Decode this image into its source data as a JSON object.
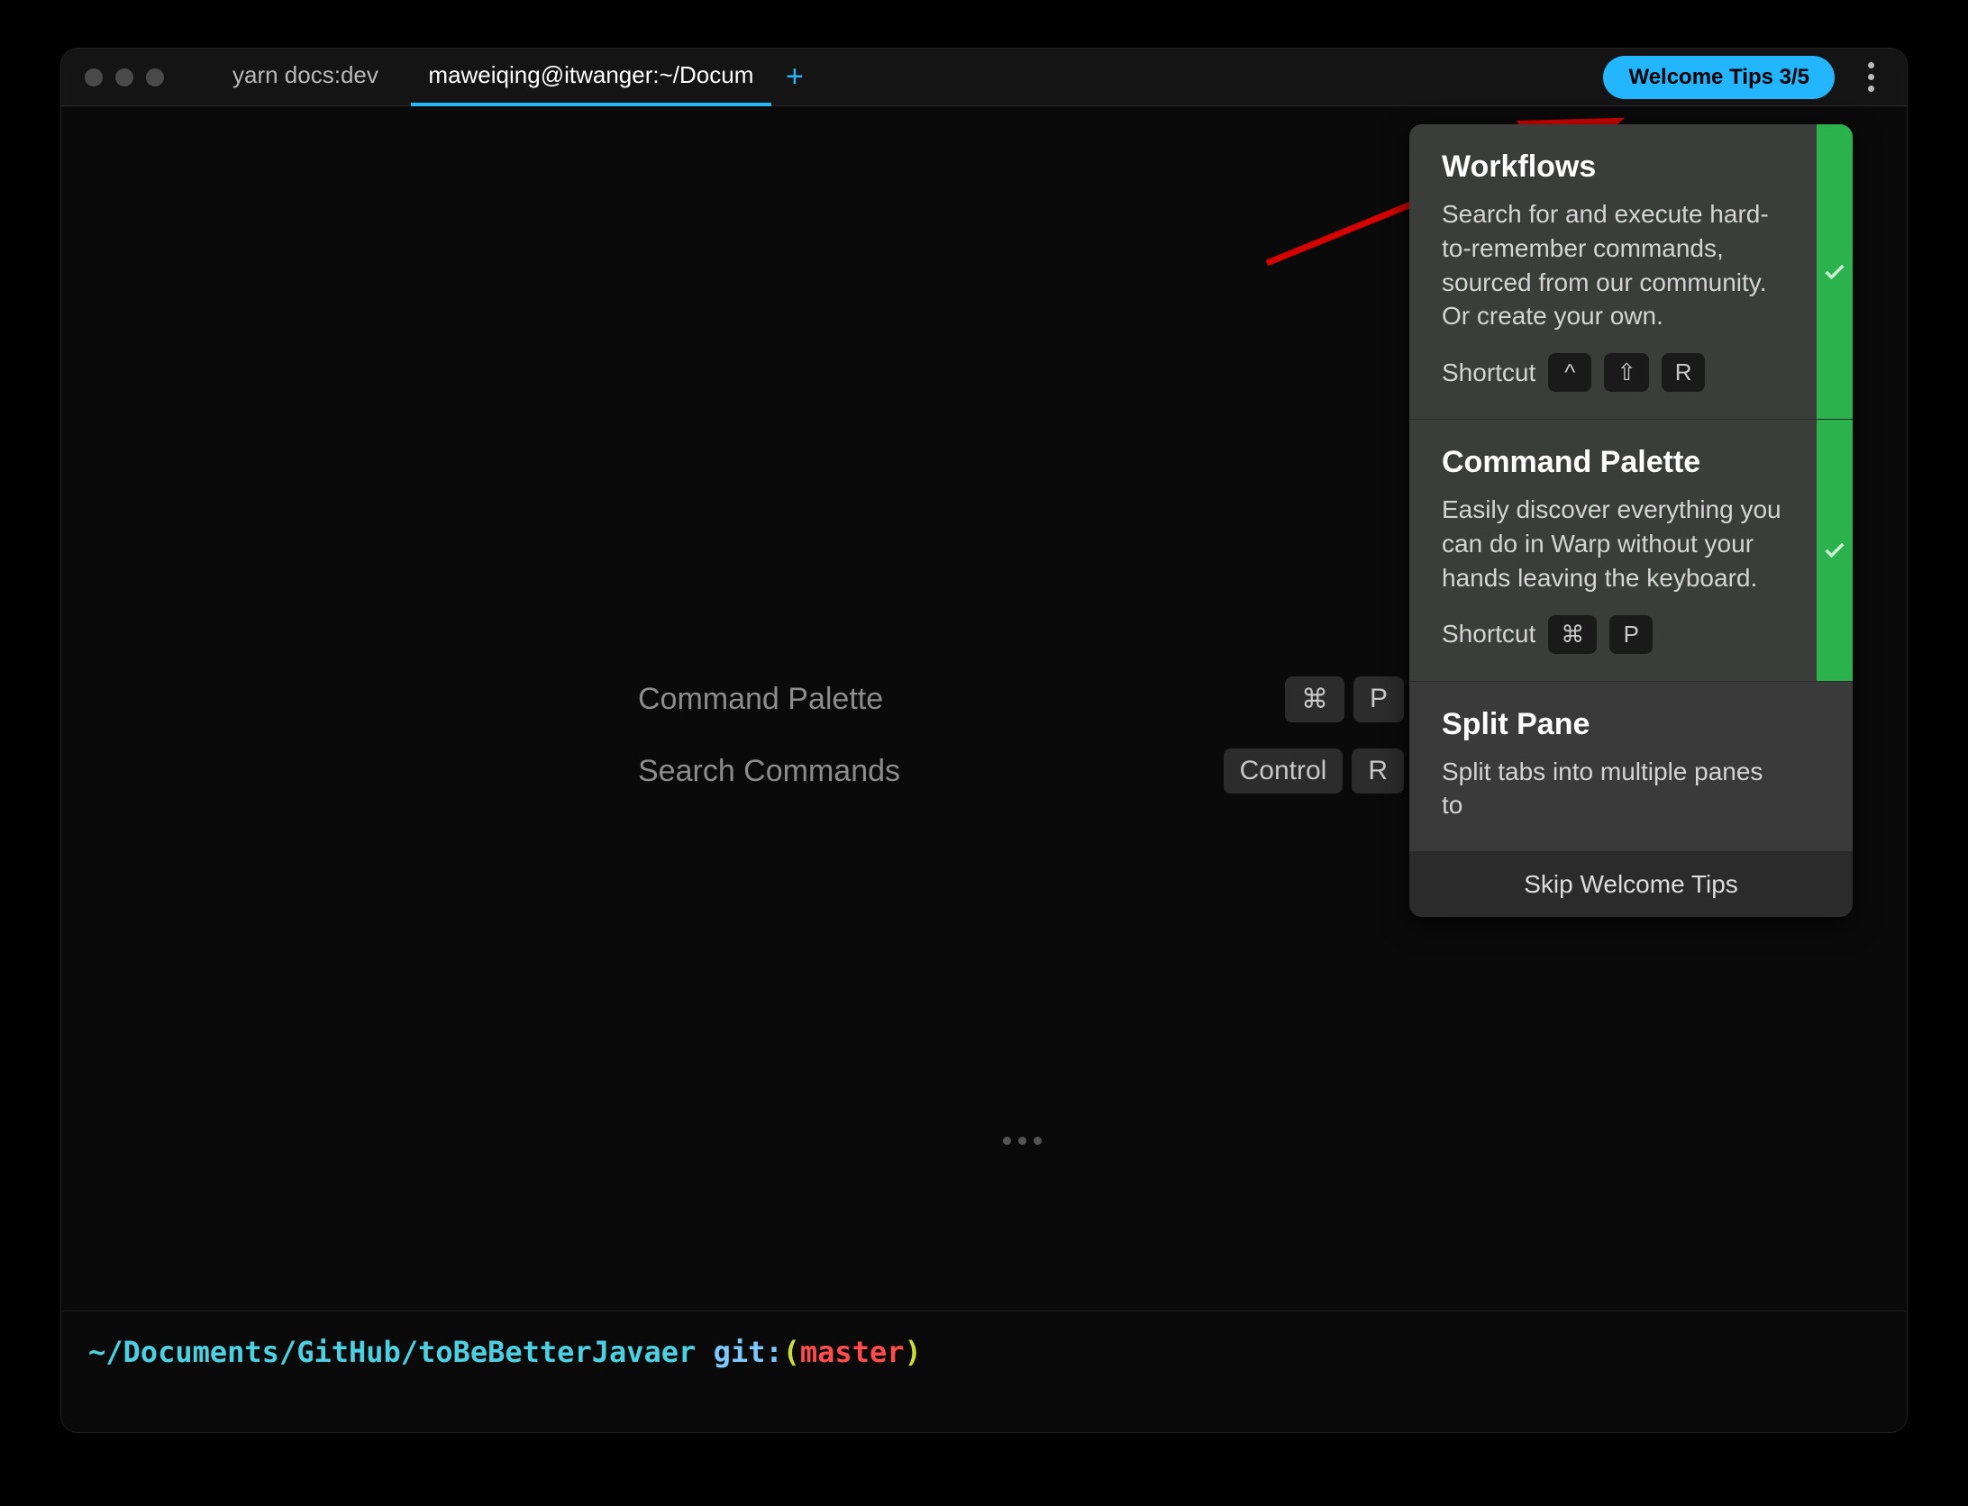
{
  "tabs": {
    "inactive_label": "yarn docs:dev",
    "active_label": "maweiqing@itwanger:~/Docum"
  },
  "header": {
    "welcome_label": "Welcome Tips 3/5"
  },
  "suggest": {
    "row0": {
      "label": "Command Palette",
      "k0": "⌘",
      "k1": "P"
    },
    "row1": {
      "label": "Search Commands",
      "k0": "Control",
      "k1": "R"
    }
  },
  "tips": {
    "card0": {
      "title": "Workflows",
      "body": "Search for and execute hard-to-remember commands, sourced from our community. Or create your own.",
      "shortcut_label": "Shortcut",
      "k0": "^",
      "k1": "⇧",
      "k2": "R"
    },
    "card1": {
      "title": "Command Palette",
      "body": "Easily discover everything you can do in Warp without your hands leaving the keyboard.",
      "shortcut_label": "Shortcut",
      "k0": "⌘",
      "k1": "P"
    },
    "card2": {
      "title": "Split Pane",
      "body": "Split tabs into multiple panes to"
    },
    "skip_label": "Skip Welcome Tips"
  },
  "prompt": {
    "path": "~/Documents/GitHub/toBeBetterJavaer ",
    "git": "git",
    "colon": ":",
    "lpar": "(",
    "branch": "master",
    "rpar": ")"
  }
}
